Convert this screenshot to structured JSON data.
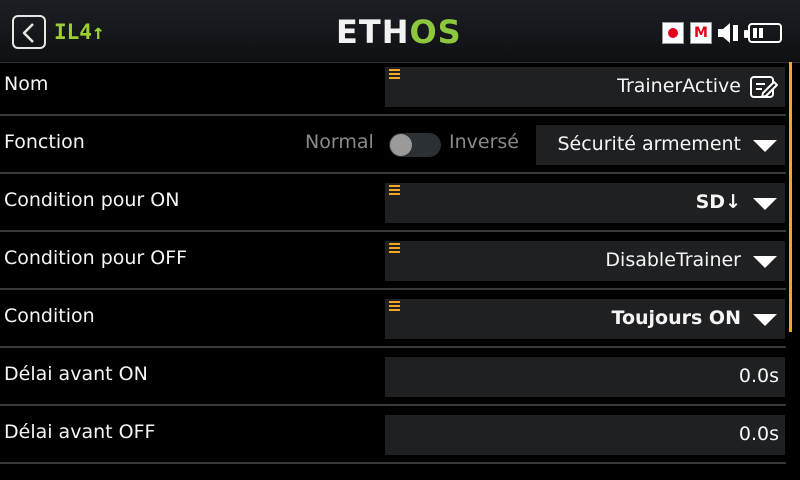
{
  "header": {
    "model_name": "IL4↑",
    "logo_eth": "ETH",
    "logo_os": "OS",
    "mute_icon_label": "M"
  },
  "rows": [
    {
      "label": "Nom",
      "value": "TrainerActive",
      "icon": "edit-icon"
    },
    {
      "label": "Fonction",
      "toggle_off": "Normal",
      "toggle_on": "Inversé",
      "value": "Sécurité armement",
      "icon": "chevron-down-icon"
    },
    {
      "label": "Condition pour ON",
      "value": "SD↓",
      "icon": "chevron-down-icon"
    },
    {
      "label": "Condition pour OFF",
      "value": "DisableTrainer",
      "icon": "chevron-down-icon"
    },
    {
      "label": "Condition",
      "value": "Toujours ON",
      "icon": "chevron-down-icon"
    },
    {
      "label": "Délai avant ON",
      "value": "0.0s"
    },
    {
      "label": "Délai avant OFF",
      "value": "0.0s"
    }
  ],
  "colors": {
    "accent": "#f5a623",
    "model_name": "#9bd12e",
    "logo_green": "#8dc63f",
    "field_bg": "#1e2022"
  }
}
